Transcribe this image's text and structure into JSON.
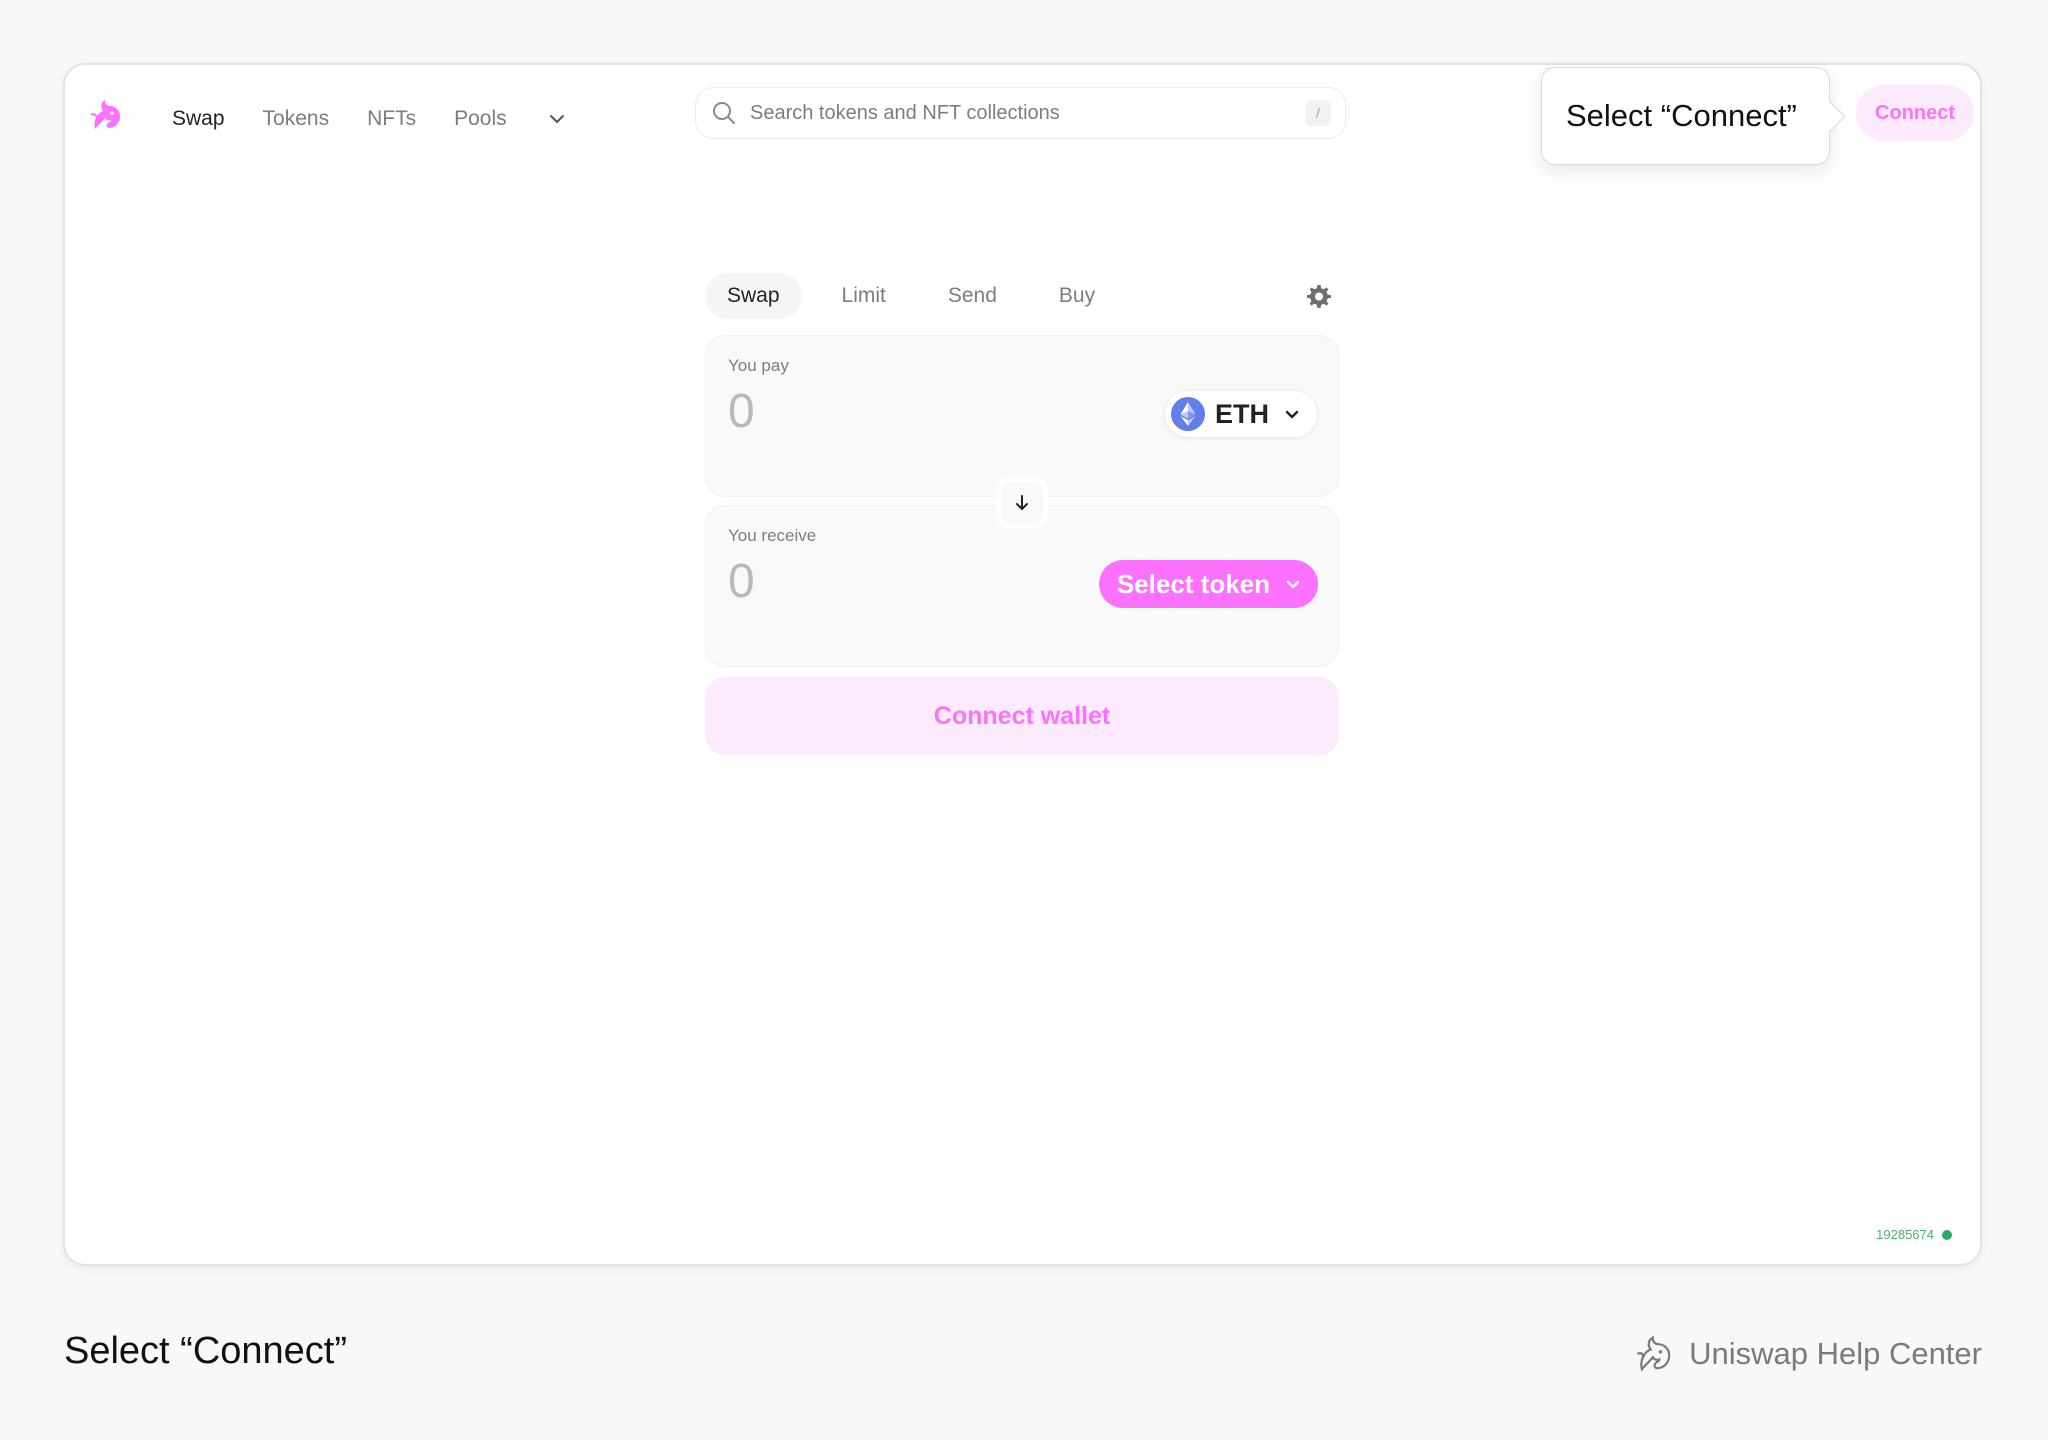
{
  "nav": {
    "items": [
      {
        "label": "Swap",
        "active": true
      },
      {
        "label": "Tokens",
        "active": false
      },
      {
        "label": "NFTs",
        "active": false
      },
      {
        "label": "Pools",
        "active": false
      }
    ],
    "more_icon": "chevron-down-icon"
  },
  "search": {
    "placeholder": "Search tokens and NFT collections",
    "shortcut": "/"
  },
  "header": {
    "connect_label": "Connect"
  },
  "callout": {
    "text": "Select “Connect”"
  },
  "swap": {
    "tabs": [
      {
        "label": "Swap",
        "active": true
      },
      {
        "label": "Limit",
        "active": false
      },
      {
        "label": "Send",
        "active": false
      },
      {
        "label": "Buy",
        "active": false
      }
    ],
    "pay": {
      "label": "You pay",
      "amount": "0",
      "token": "ETH"
    },
    "receive": {
      "label": "You receive",
      "amount": "0",
      "select_label": "Select token"
    },
    "connect_wallet_label": "Connect wallet"
  },
  "status": {
    "block_number": "19285674"
  },
  "footer": {
    "caption": "Select “Connect”",
    "brand": "Uniswap Help Center"
  },
  "colors": {
    "accent": "#fc72ff",
    "accent_soft": "#fdeafc",
    "eth": "#627eea",
    "status_green": "#27ae60"
  }
}
